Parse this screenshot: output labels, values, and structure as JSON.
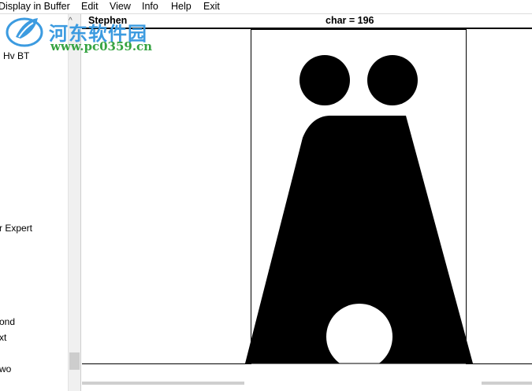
{
  "menu": {
    "items": [
      "Display in Buffer",
      "Edit",
      "View",
      "Info",
      "Help",
      "Exit"
    ]
  },
  "font_list": {
    "sort_indicator": "^",
    "items": [
      "Hv BT",
      "r Expert",
      "ond",
      "xt",
      "wo"
    ]
  },
  "header": {
    "font_name": "Stephen",
    "char_label": "char = 196"
  },
  "watermark": {
    "title": "河东软件园",
    "url": "www.pc0359.cn",
    "logo_icon": "leaf-logo-icon"
  },
  "glyph": {
    "character_code": 196,
    "fill_color": "#000000"
  },
  "colors": {
    "watermark_title": "#3c9be0",
    "watermark_url": "#36a342"
  }
}
